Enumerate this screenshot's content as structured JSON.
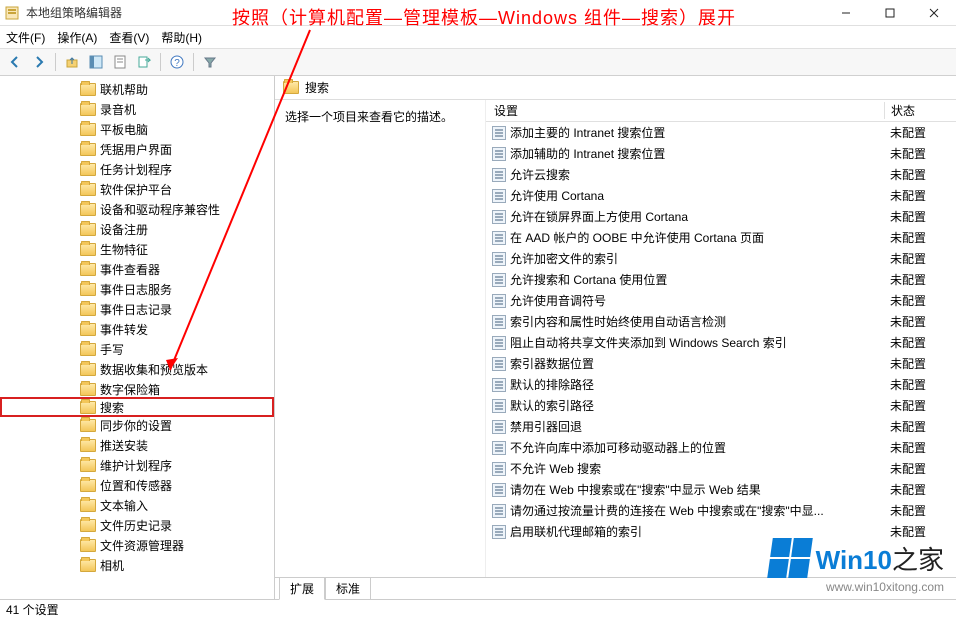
{
  "window": {
    "title": "本地组策略编辑器"
  },
  "annotation": "按照（计算机配置—管理模板—Windows 组件—搜索）展开",
  "menu": {
    "file": "文件(F)",
    "action": "操作(A)",
    "view": "查看(V)",
    "help": "帮助(H)"
  },
  "tree": {
    "items": [
      "联机帮助",
      "录音机",
      "平板电脑",
      "凭据用户界面",
      "任务计划程序",
      "软件保护平台",
      "设备和驱动程序兼容性",
      "设备注册",
      "生物特征",
      "事件查看器",
      "事件日志服务",
      "事件日志记录",
      "事件转发",
      "手写",
      "数据收集和预览版本",
      "数字保险箱",
      "搜索",
      "同步你的设置",
      "推送安装",
      "维护计划程序",
      "位置和传感器",
      "文本输入",
      "文件历史记录",
      "文件资源管理器",
      "相机"
    ],
    "selected_index": 16
  },
  "right": {
    "header": "搜索",
    "description": "选择一个项目来查看它的描述。",
    "columns": {
      "setting": "设置",
      "status": "状态"
    },
    "rows": [
      {
        "label": "添加主要的 Intranet 搜索位置",
        "status": "未配置"
      },
      {
        "label": "添加辅助的 Intranet 搜索位置",
        "status": "未配置"
      },
      {
        "label": "允许云搜索",
        "status": "未配置"
      },
      {
        "label": "允许使用 Cortana",
        "status": "未配置"
      },
      {
        "label": "允许在锁屏界面上方使用 Cortana",
        "status": "未配置"
      },
      {
        "label": "在 AAD 帐户的 OOBE 中允许使用 Cortana 页面",
        "status": "未配置"
      },
      {
        "label": "允许加密文件的索引",
        "status": "未配置"
      },
      {
        "label": "允许搜索和 Cortana 使用位置",
        "status": "未配置"
      },
      {
        "label": "允许使用音调符号",
        "status": "未配置"
      },
      {
        "label": "索引内容和属性时始终使用自动语言检测",
        "status": "未配置"
      },
      {
        "label": "阻止自动将共享文件夹添加到 Windows Search 索引",
        "status": "未配置"
      },
      {
        "label": "索引器数据位置",
        "status": "未配置"
      },
      {
        "label": "默认的排除路径",
        "status": "未配置"
      },
      {
        "label": "默认的索引路径",
        "status": "未配置"
      },
      {
        "label": "禁用引器回退",
        "status": "未配置"
      },
      {
        "label": "不允许向库中添加可移动驱动器上的位置",
        "status": "未配置"
      },
      {
        "label": "不允许 Web 搜索",
        "status": "未配置"
      },
      {
        "label": "请勿在 Web 中搜索或在\"搜索\"中显示 Web 结果",
        "status": "未配置"
      },
      {
        "label": "请勿通过按流量计费的连接在 Web 中搜索或在\"搜索\"中显...",
        "status": "未配置"
      },
      {
        "label": "启用联机代理邮箱的索引",
        "status": "未配置"
      }
    ]
  },
  "tabs": {
    "extended": "扩展",
    "standard": "标准"
  },
  "statusbar": "41 个设置",
  "watermark": {
    "brand_a": "Win10",
    "brand_b": "之家",
    "url": "www.win10xitong.com"
  }
}
